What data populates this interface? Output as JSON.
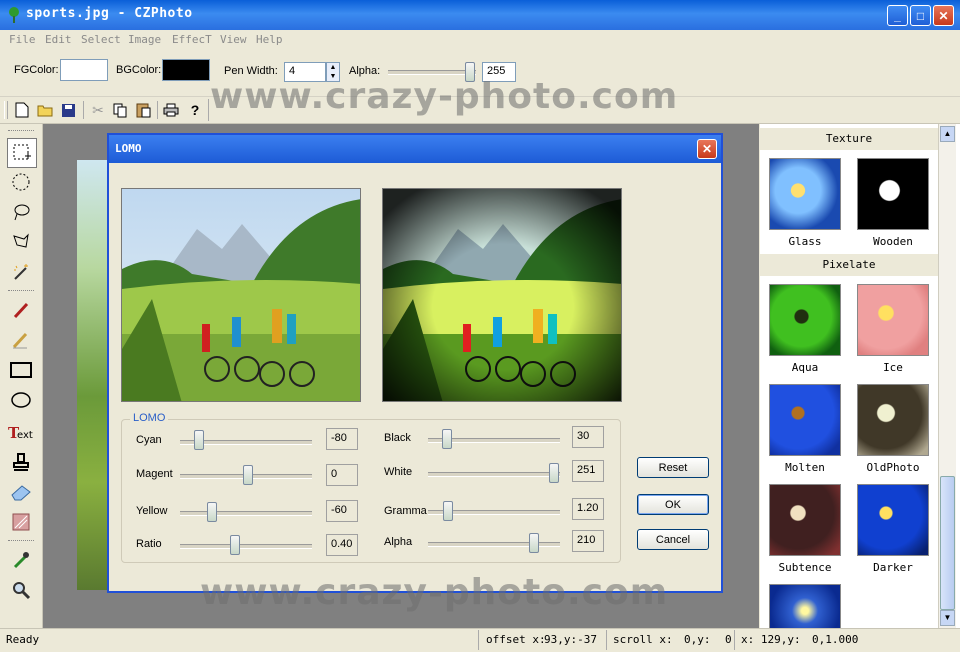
{
  "window": {
    "title": "sports.jpg - CZPhoto"
  },
  "menu": {
    "items": [
      "File",
      "Edit",
      "Select",
      "Image",
      "EffecT",
      "View",
      "Help"
    ]
  },
  "options": {
    "fg_label": "FGColor:",
    "bg_label": "BGColor:",
    "fg_color": "#ffffff",
    "bg_color": "#000000",
    "pen_width_label": "Pen Width:",
    "pen_width_value": "4",
    "alpha_label": "Alpha:",
    "alpha_value": "255"
  },
  "watermark": {
    "text": "www.crazy-photo.com"
  },
  "dialog": {
    "title": "LOMO",
    "group_label": "LOMO",
    "sliders_left": [
      {
        "label": "Cyan",
        "value": "-80"
      },
      {
        "label": "Magent",
        "value": "0"
      },
      {
        "label": "Yellow",
        "value": "-60"
      },
      {
        "label": "Ratio",
        "value": "0.40"
      }
    ],
    "sliders_right": [
      {
        "label": "Black",
        "value": "30"
      },
      {
        "label": "White",
        "value": "251"
      },
      {
        "label": "Gramma",
        "value": "1.20"
      },
      {
        "label": "Alpha",
        "value": "210"
      }
    ],
    "buttons": {
      "reset": "Reset",
      "ok": "OK",
      "cancel": "Cancel"
    }
  },
  "effects": {
    "groups": [
      {
        "title": "Texture",
        "items": [
          "Glass",
          "Wooden"
        ]
      },
      {
        "title": "Pixelate",
        "items": [
          "Aqua",
          "Ice",
          "Molten",
          "OldPhoto",
          "Subtence",
          "Darker"
        ]
      }
    ]
  },
  "status": {
    "text": "Ready",
    "offset_label": "offset x:",
    "offset_value": "93,y:-37",
    "scroll_label": "scroll x:",
    "scroll_value": "0,y:",
    "scroll_y": "0",
    "xy_label": "x: 129,y:",
    "xy_value": "0,1.000"
  }
}
